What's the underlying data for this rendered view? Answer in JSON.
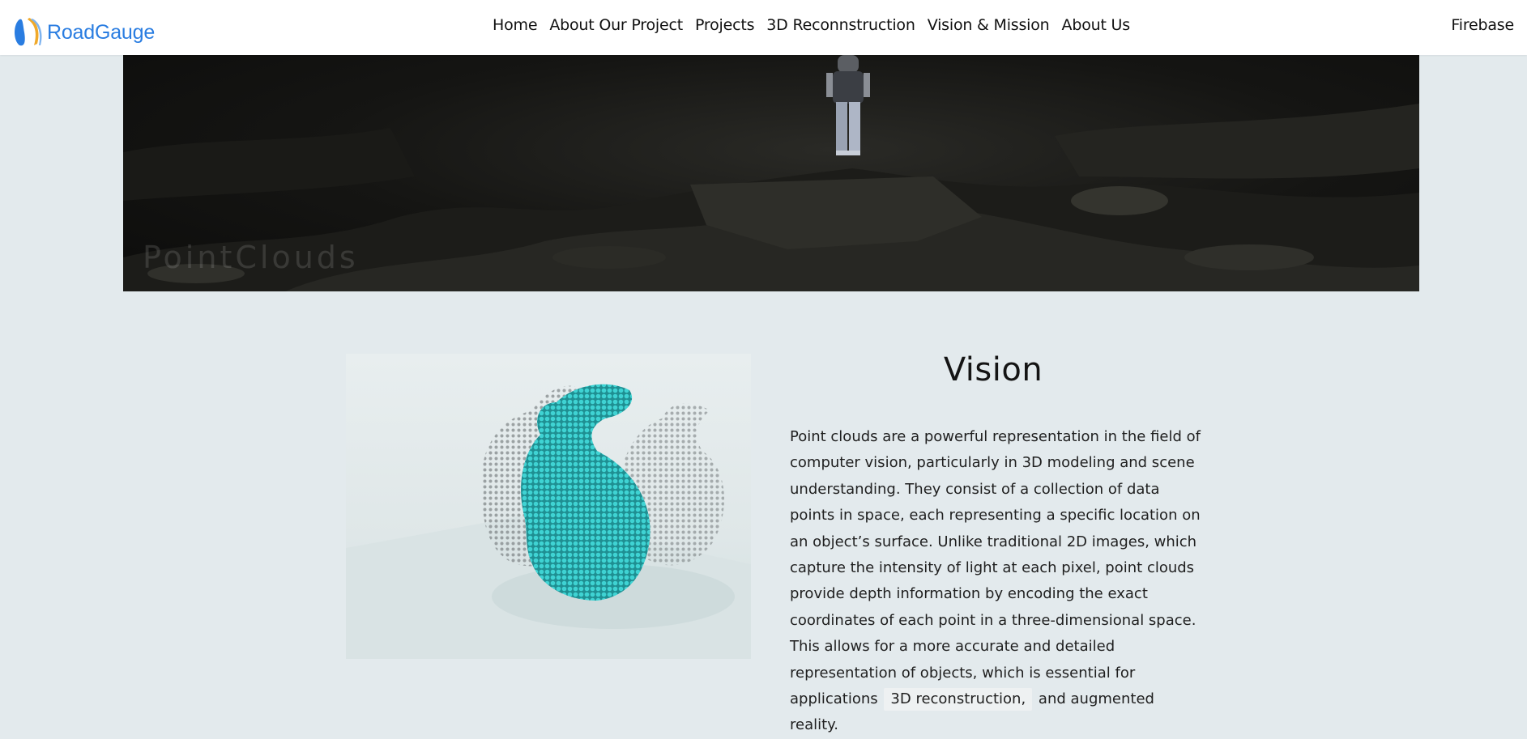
{
  "brand": {
    "name": "RoadGauge",
    "logo_icon": "roadgauge-logo-icon",
    "color": "#2a7de1"
  },
  "nav": {
    "links": [
      "Home",
      "About Our Project",
      "Projects",
      "3D Reconnstruction",
      "Vision & Mission",
      "About Us"
    ],
    "right_link": "Firebase"
  },
  "hero": {
    "title": "PointClouds"
  },
  "content": {
    "image_alt": "bunny point cloud",
    "heading": "Vision",
    "paragraph_before": "Point clouds are a powerful representation in the field of computer vision, particularly in 3D modeling and scene understanding. They consist of a collection of data points in space, each representing a specific location on an object’s surface. Unlike traditional 2D images, which capture the intensity of light at each pixel, point clouds provide depth information by encoding the exact coordinates of each point in a three-dimensional space. This allows for a more accurate and detailed representation of objects, which is essential for applications",
    "chip": "3D reconstruction,",
    "paragraph_after": "and augmented reality."
  },
  "colors": {
    "background": "#e3eaed",
    "navbar": "#ffffff",
    "point_cloud": "#3ccfcf"
  }
}
